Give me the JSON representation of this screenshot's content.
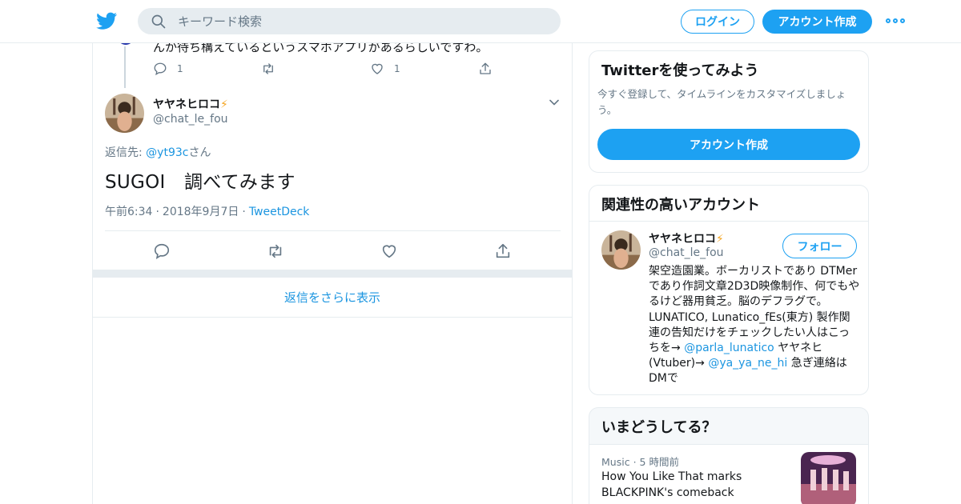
{
  "header": {
    "logo": "twitter-bird-icon",
    "search_placeholder": "キーワード検索",
    "login_label": "ログイン",
    "signup_label": "アカウント作成",
    "more": "more-icon"
  },
  "previous_tweet": {
    "text": "んか待ち構えているというスマホアプリがあるらしいですわ。",
    "reply_count": "1",
    "like_count": "1"
  },
  "tweet": {
    "name": "ヤヤネヒロコ",
    "name_emoji": "⚡",
    "handle": "@chat_le_fou",
    "reply_prefix": "返信先: ",
    "reply_handle": "@yt93c",
    "reply_suffix": "さん",
    "text": "SUGOI　調べてみます",
    "time": "午前6:34",
    "date": "2018年9月7日",
    "source": "TweetDeck",
    "dot": "·"
  },
  "show_more_replies": "返信をさらに表示",
  "signup_card": {
    "title": "Twitterを使ってみよう",
    "description": "今すぐ登録して、タイムラインをカスタマイズしましょう。",
    "button": "アカウント作成"
  },
  "related_card": {
    "title": "関連性の高いアカウント",
    "name": "ヤヤネヒロコ",
    "name_emoji": "⚡",
    "handle": "@chat_le_fou",
    "follow_label": "フォロー",
    "bio_part1": "架空造園業。ボーカリストであり DTMerであり作詞文章2D3D映像制作、何でもやるけど器用貧乏。脳のデフラグで。LUNATICO, Lunatico_fEs(東方) 製作関連の告知だけをチェックしたい人はこっちを→ ",
    "bio_link1": "@parla_lunatico",
    "bio_part2": " ヤヤネヒ(Vtuber)→ ",
    "bio_link2": "@ya_ya_ne_hi",
    "bio_part3": " 急ぎ連絡はDMで"
  },
  "trends_card": {
    "title": "いまどうしてる？",
    "category": "Music",
    "dot": "·",
    "time_ago": "5 時間前",
    "headline": "How You Like That marks BLACKPINK's comeback"
  },
  "colors": {
    "brand": "#1da1f2",
    "link": "#1b95e0",
    "muted": "#657786",
    "border": "#e6ecf0"
  }
}
